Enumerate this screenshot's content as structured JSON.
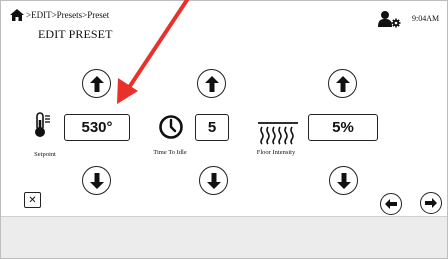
{
  "header": {
    "breadcrumb": ">EDIT>Presets>Preset",
    "title": "EDIT PRESET",
    "time": "9:04AM"
  },
  "settings": [
    {
      "id": "setpoint",
      "value": "530°",
      "label": "Setpoint"
    },
    {
      "id": "time_to_idle",
      "value": "5",
      "label": "Time To Idle"
    },
    {
      "id": "floor_intensity",
      "value": "5%",
      "label": "Floor Intensity"
    }
  ],
  "icons": {
    "home": "home-icon",
    "user_settings": "user-gear-icon",
    "thermometer": "thermometer-icon",
    "clock": "clock-icon",
    "floor_heat": "floor-heat-icon",
    "up": "arrow-up-icon",
    "down": "arrow-down-icon",
    "left": "arrow-left-icon",
    "right": "arrow-right-icon",
    "close": "close-icon"
  },
  "colors": {
    "annotation_arrow": "#e8312a",
    "bottom_bar": "#ececec"
  }
}
